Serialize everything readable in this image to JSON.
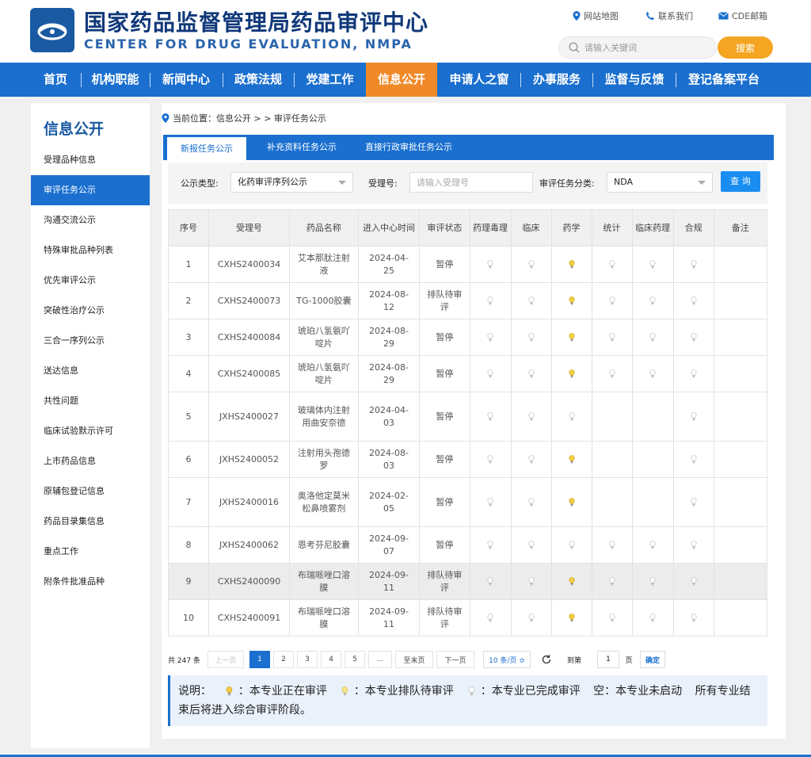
{
  "header": {
    "title_cn": "国家药品监督管理局药品审评中心",
    "title_en": "CENTER FOR DRUG EVALUATION, NMPA",
    "links": [
      {
        "label": "网站地图",
        "icon": "map-pin-icon"
      },
      {
        "label": "联系我们",
        "icon": "phone-icon"
      },
      {
        "label": "CDE邮箱",
        "icon": "mail-icon"
      }
    ],
    "search_placeholder": "请输入关键词",
    "search_button": "搜索"
  },
  "nav": {
    "items": [
      "首页",
      "机构职能",
      "新闻中心",
      "政策法规",
      "党建工作",
      "信息公开",
      "申请人之窗",
      "办事服务",
      "监督与反馈",
      "登记备案平台"
    ],
    "active": "信息公开"
  },
  "sidebar": {
    "title": "信息公开",
    "items": [
      "受理品种信息",
      "审评任务公示",
      "沟通交流公示",
      "特殊审批品种列表",
      "优先审评公示",
      "突破性治疗公示",
      "三合一序列公示",
      "送达信息",
      "共性问题",
      "临床试验默示许可",
      "上市药品信息",
      "原辅包登记信息",
      "药品目录集信息",
      "重点工作",
      "附条件批准品种"
    ],
    "active": "审评任务公示"
  },
  "breadcrumb": "当前位置：信息公开 > > 审评任务公示",
  "tabs": [
    "新报任务公示",
    "补充资料任务公示",
    "直接行政审批任务公示"
  ],
  "filter": {
    "type_label": "公示类型:",
    "type_value": "化药审评序列公示",
    "no_label": "受理号:",
    "no_placeholder": "请输入受理号",
    "cat_label": "审评任务分类:",
    "cat_value": "NDA",
    "query_button": "查 询"
  },
  "table": {
    "headers": [
      "序号",
      "受理号",
      "药品名称",
      "进入中心时间",
      "审评状态",
      "药理毒理",
      "临床",
      "药学",
      "统计",
      "临床药理",
      "合规",
      "备注"
    ],
    "rows": [
      {
        "no": "1",
        "id": "CXHS2400034",
        "name": "艾本那肽注射液",
        "date": "2024-04-25",
        "status": "暂停",
        "s": [
          "done",
          "done",
          "active",
          "done",
          "done",
          "done"
        ]
      },
      {
        "no": "2",
        "id": "CXHS2400073",
        "name": "TG-1000胶囊",
        "date": "2024-08-12",
        "status": "排队待审评",
        "s": [
          "done",
          "done",
          "active",
          "done",
          "done",
          "done"
        ]
      },
      {
        "no": "3",
        "id": "CXHS2400084",
        "name": "琥珀八氢氨吖啶片",
        "date": "2024-08-29",
        "status": "暂停",
        "s": [
          "done",
          "done",
          "active",
          "done",
          "done",
          "done"
        ]
      },
      {
        "no": "4",
        "id": "CXHS2400085",
        "name": "琥珀八氢氨吖啶片",
        "date": "2024-08-29",
        "status": "暂停",
        "s": [
          "done",
          "done",
          "active",
          "done",
          "done",
          "done"
        ]
      },
      {
        "no": "5",
        "id": "JXHS2400027",
        "name": "玻璃体内注射用曲安奈德",
        "date": "2024-04-03",
        "status": "暂停",
        "s": [
          "done",
          "done",
          "done",
          "",
          "",
          "done"
        ]
      },
      {
        "no": "6",
        "id": "JXHS2400052",
        "name": "注射用头孢德罗",
        "date": "2024-08-03",
        "status": "暂停",
        "s": [
          "done",
          "done",
          "active",
          "",
          "",
          "done"
        ]
      },
      {
        "no": "7",
        "id": "JXHS2400016",
        "name": "奥洛他定莫米松鼻喷雾剂",
        "date": "2024-02-05",
        "status": "暂停",
        "s": [
          "done",
          "done",
          "active",
          "",
          "",
          "done"
        ]
      },
      {
        "no": "8",
        "id": "JXHS2400062",
        "name": "恩考芬尼胶囊",
        "date": "2024-09-07",
        "status": "暂停",
        "s": [
          "done",
          "done",
          "done",
          "done",
          "done",
          "done"
        ]
      },
      {
        "no": "9",
        "id": "CXHS2400090",
        "name": "布瑞哌唑口溶膜",
        "date": "2024-09-11",
        "status": "排队待审评",
        "s": [
          "done",
          "done",
          "active",
          "done",
          "done",
          "done"
        ]
      },
      {
        "no": "10",
        "id": "CXHS2400091",
        "name": "布瑞哌唑口溶膜",
        "date": "2024-09-11",
        "status": "排队待审评",
        "s": [
          "done",
          "done",
          "active",
          "done",
          "done",
          "done"
        ]
      }
    ],
    "highlighted_row": 9
  },
  "pagination": {
    "total": "共 247 条",
    "prev": "上一页",
    "pages": [
      "1",
      "2",
      "3",
      "4",
      "5",
      "..."
    ],
    "current": "1",
    "last": "至末页",
    "next": "下一页",
    "size": "10 条/页 ≎",
    "goto": "到第",
    "goto_value": "1",
    "page_unit": "页",
    "confirm": "确定"
  },
  "legend": {
    "prefix": "说明：",
    "items": [
      {
        "icon": "active",
        "text": "：本专业正在审评"
      },
      {
        "icon": "queue",
        "text": "：本专业排队待审评"
      },
      {
        "icon": "done",
        "text": "：本专业已完成审评"
      }
    ],
    "empty_text": "空：本专业未启动",
    "suffix": "所有专业结束后将进入综合审评阶段。"
  },
  "colors": {
    "brand": "#1a6fcf",
    "active_nav": "#f08a28",
    "bulb_active": "#e6b820",
    "bulb_done": "#bbbbbb"
  }
}
